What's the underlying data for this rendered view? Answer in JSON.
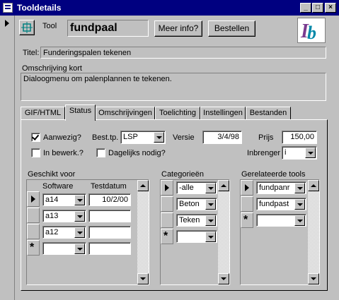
{
  "window": {
    "title": "Tooldetails"
  },
  "header": {
    "tool_label": "Tool",
    "tool_value": "fundpaal",
    "more_info_button": "Meer info?",
    "close_button": "Bestellen"
  },
  "fields": {
    "title_label": "Titel:",
    "title_value": "Funderingspalen tekenen",
    "desc_label": "Omschrijving kort",
    "desc_value": "Dialoogmenu om palenplannen te tekenen."
  },
  "tabs": [
    "GIF/HTML",
    "Status",
    "Omschrijvingen",
    "Toelichting",
    "Instellingen",
    "Bestanden"
  ],
  "status": {
    "present_label": "Aanwezig?",
    "present_checked": true,
    "in_progress_label": "In bewerk.?",
    "in_progress_checked": false,
    "daily_label": "Dagelijks nodig?",
    "daily_checked": false,
    "besttp_label": "Best.tp.",
    "besttp_value": "LSP",
    "version_label": "Versie",
    "version_value": "3/4/98",
    "price_label": "Prijs",
    "price_value": "150,00",
    "inbrenger_label": "Inbrenger",
    "inbrenger_value": "i"
  },
  "geschikt": {
    "title": "Geschikt voor",
    "col_software": "Software",
    "col_testdatum": "Testdatum",
    "rows": [
      {
        "software": "a14",
        "testdatum": "10/2/00"
      },
      {
        "software": "a13",
        "testdatum": ""
      },
      {
        "software": "a12",
        "testdatum": ""
      },
      {
        "software": "",
        "testdatum": ""
      }
    ]
  },
  "categorieen": {
    "title": "Categorieën",
    "rows": [
      "-alle",
      "Beton",
      "Teken",
      ""
    ]
  },
  "gerelateerde": {
    "title": "Gerelateerde tools",
    "rows": [
      "fundpanr",
      "fundpast",
      ""
    ]
  }
}
